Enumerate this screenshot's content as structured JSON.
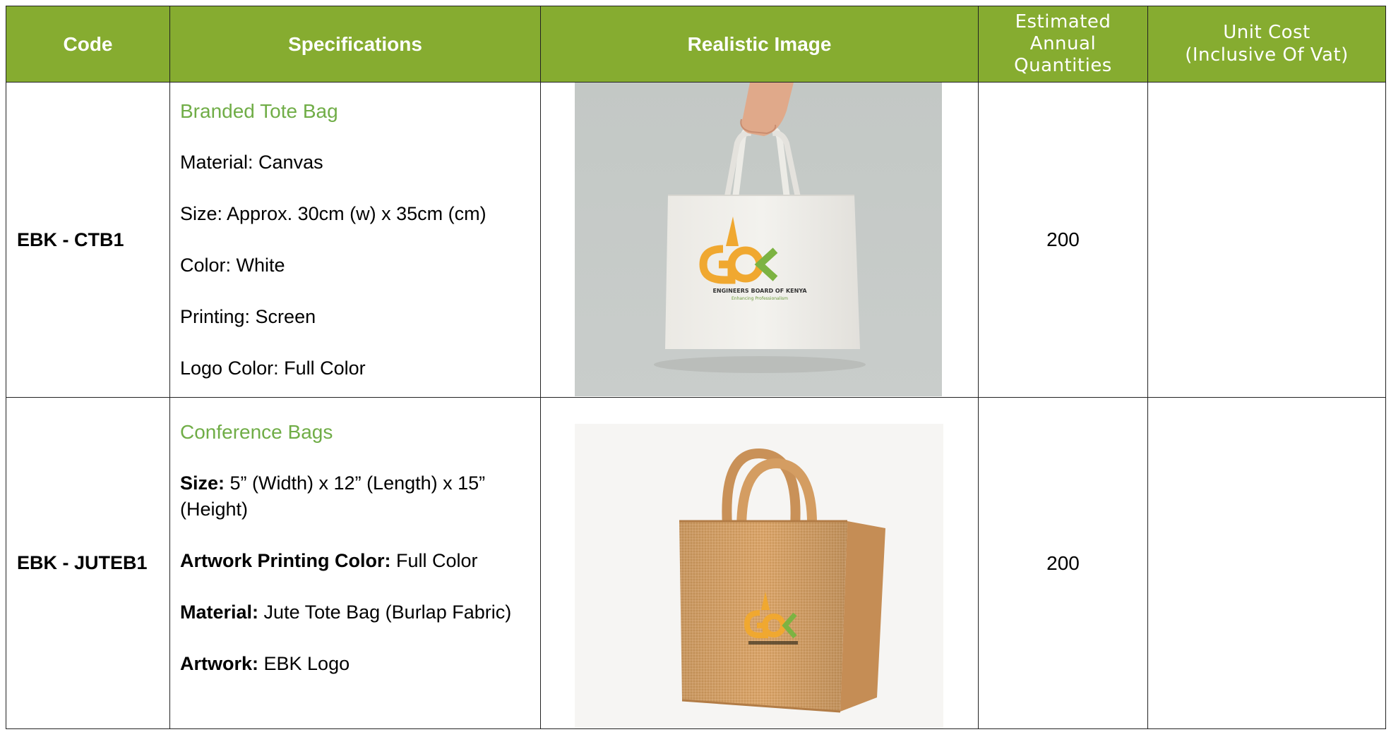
{
  "header": {
    "code": "Code",
    "specifications": "Specifications",
    "realistic_image": "Realistic Image",
    "estimated_line1": "Estimated",
    "estimated_line2": "Annual",
    "estimated_line3": "Quantities",
    "unit_cost_line1": "Unit Cost",
    "unit_cost_line2": "(Inclusive Of Vat)"
  },
  "rows": [
    {
      "code": "EBK - CTB1",
      "title": "Branded Tote Bag",
      "specs": [
        "Material: Canvas",
        "Size: Approx. 30cm (w) x 35cm (cm)",
        "Color: White",
        "Printing: Screen",
        "Logo Color: Full Color"
      ],
      "quantity": "200",
      "unit_cost": "",
      "image": {
        "logo_text": "ENGINEERS BOARD OF KENYA",
        "logo_tagline": "Enhancing Professionalism"
      }
    },
    {
      "code": "EBK - JUTEB1",
      "title": "Conference Bags",
      "specs": [
        {
          "label": "Size:",
          "value": " 5” (Width) x 12” (Length) x 15” (Height)"
        },
        {
          "label": "Artwork Printing Color:",
          "value": " Full Color"
        },
        {
          "label": "Material:",
          "value": " Jute Tote Bag (Burlap Fabric)"
        },
        {
          "label": "Artwork:",
          "value": " EBK Logo"
        }
      ],
      "quantity": "200",
      "unit_cost": ""
    }
  ],
  "colors": {
    "header_bg": "#86ac30",
    "title_green": "#70ad47",
    "logo_orange": "#f0a830",
    "logo_green": "#7cb342"
  }
}
